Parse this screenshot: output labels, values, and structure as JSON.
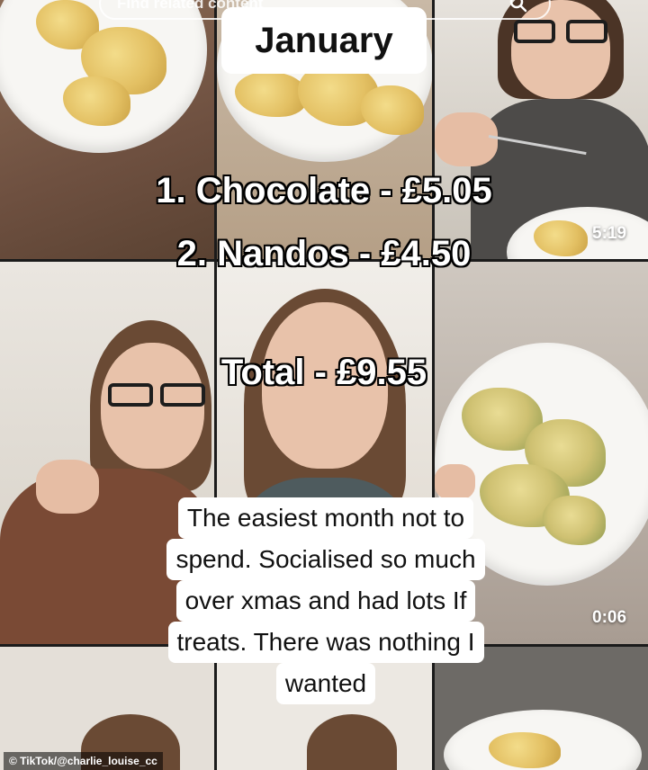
{
  "search": {
    "placeholder": "Find related content",
    "icon": "search-icon"
  },
  "overlay": {
    "title": "January",
    "items": [
      "1. Chocolate - £5.05",
      "2. Nandos - £4.50"
    ],
    "total": "Total - £9.55"
  },
  "caption": {
    "lines": [
      "The easiest month not to",
      "spend. Socialised so much",
      "over xmas and had lots If",
      "treats. There was nothing I",
      "wanted"
    ]
  },
  "timestamps": [
    "5:19",
    "0:06"
  ],
  "credit": "© TikTok/@charlie_louise_cc",
  "colors": {
    "caption_bg": "#ffffff",
    "title_bg": "#ffffff",
    "outline_text": "#ffffff"
  }
}
